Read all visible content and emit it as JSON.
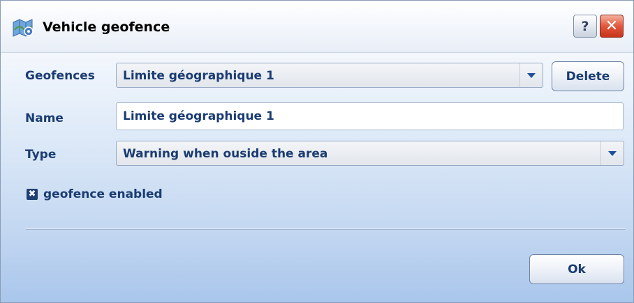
{
  "window": {
    "title": "Vehicle geofence",
    "help_label": "?",
    "close_label": "✕"
  },
  "form": {
    "geofences_label": "Geofences",
    "geofences_value": "Limite géographique 1",
    "delete_label": "Delete",
    "name_label": "Name",
    "name_value": "Limite géographique 1",
    "type_label": "Type",
    "type_value": "Warning when ouside the area",
    "enabled_label": "geofence enabled",
    "enabled_checked": true,
    "checkbox_mark": "✖"
  },
  "footer": {
    "ok_label": "Ok"
  },
  "colors": {
    "label_text": "#1a3c72",
    "close_button": "#e2573c",
    "accent_arrow": "#1f4f9c"
  }
}
